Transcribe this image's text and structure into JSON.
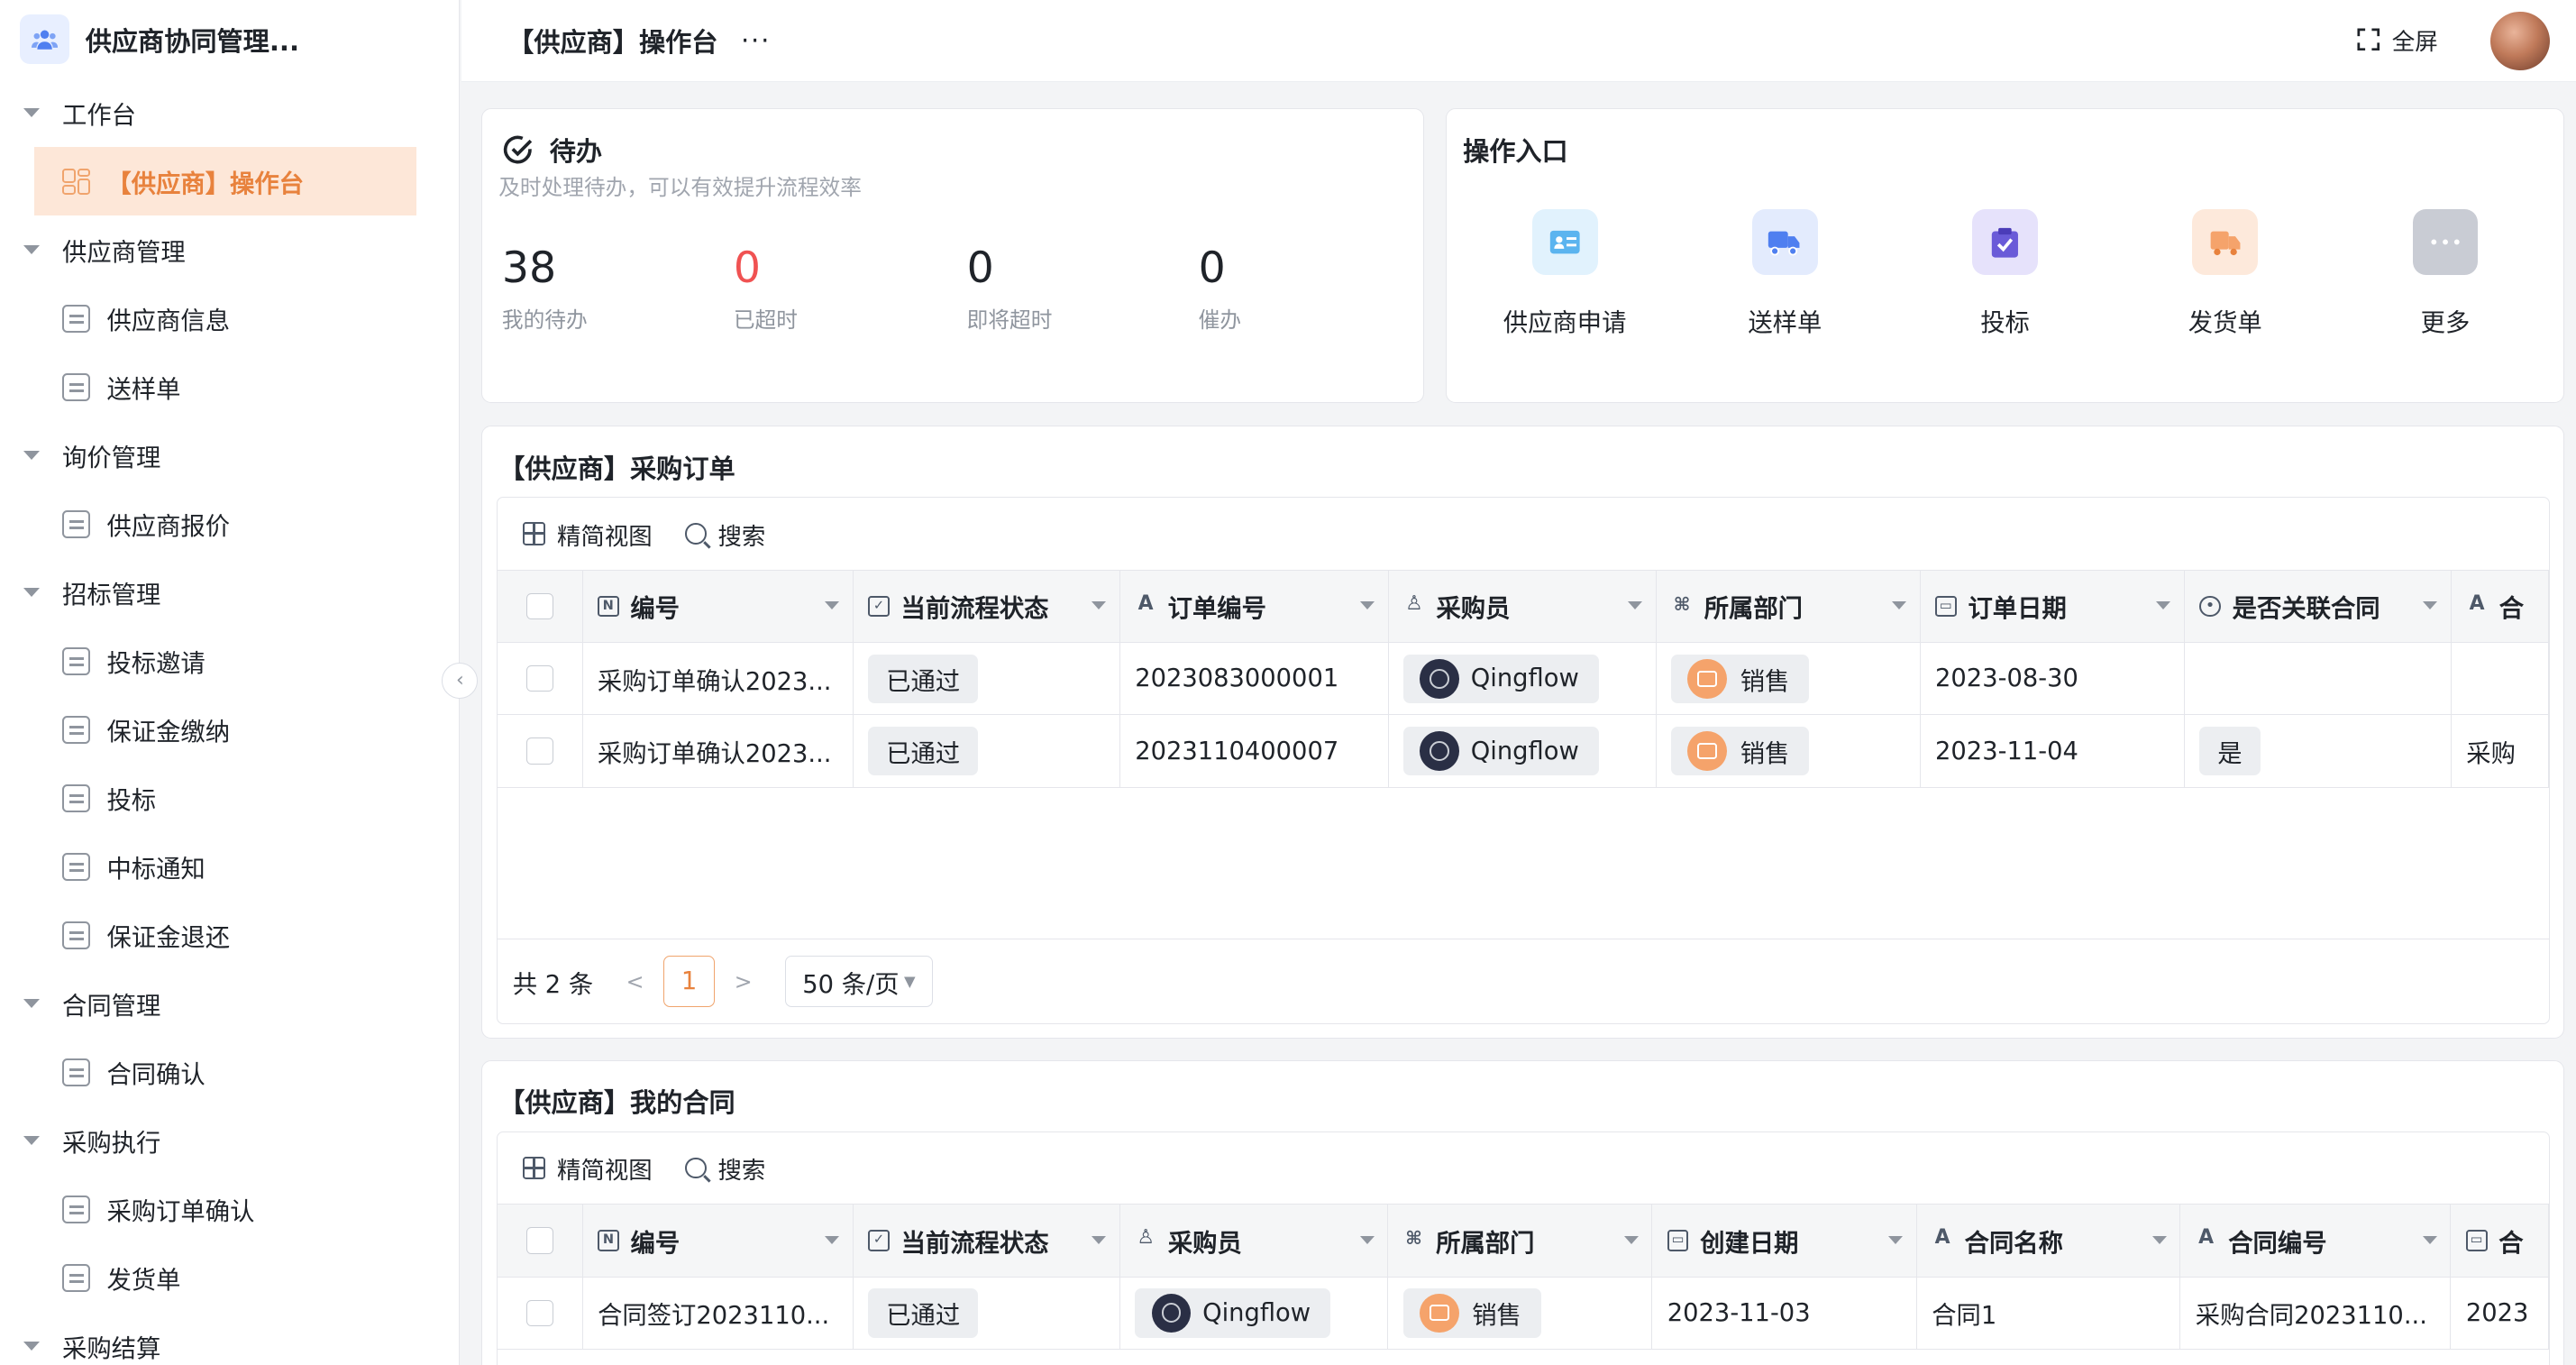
{
  "app": {
    "title": "供应商协同管理..."
  },
  "sidebar": {
    "groups": [
      {
        "label": "工作台",
        "items": [
          "【供应商】操作台"
        ]
      },
      {
        "label": "供应商管理",
        "items": [
          "供应商信息",
          "送样单"
        ]
      },
      {
        "label": "询价管理",
        "items": [
          "供应商报价"
        ]
      },
      {
        "label": "招标管理",
        "items": [
          "投标邀请",
          "保证金缴纳",
          "投标",
          "中标通知",
          "保证金退还"
        ]
      },
      {
        "label": "合同管理",
        "items": [
          "合同确认"
        ]
      },
      {
        "label": "采购执行",
        "items": [
          "采购订单确认",
          "发货单"
        ]
      },
      {
        "label": "采购结算",
        "items": []
      }
    ]
  },
  "header": {
    "title": "【供应商】操作台",
    "more": "···",
    "fullscreen": "全屏"
  },
  "todo": {
    "title": "待办",
    "subtitle": "及时处理待办，可以有效提升流程效率",
    "stats": [
      {
        "value": "38",
        "label": "我的待办"
      },
      {
        "value": "0",
        "label": "已超时"
      },
      {
        "value": "0",
        "label": "即将超时"
      },
      {
        "value": "0",
        "label": "催办"
      }
    ]
  },
  "entries": {
    "title": "操作入口",
    "items": [
      "供应商申请",
      "送样单",
      "投标",
      "发货单",
      "更多"
    ],
    "colors": [
      "#5bb4ef",
      "#4f7ff0",
      "#6a5bd8",
      "#f5a36b",
      "#b9bdc6"
    ]
  },
  "toolbar": {
    "view": "精简视图",
    "search": "搜索"
  },
  "orders": {
    "title": "【供应商】采购订单",
    "columns": [
      "编号",
      "当前流程状态",
      "订单编号",
      "采购员",
      "所属部门",
      "订单日期",
      "是否关联合同",
      "合"
    ],
    "rows": [
      [
        "采购订单确认2023...",
        "已通过",
        "2023083000001",
        "Qingflow",
        "销售",
        "2023-08-30",
        "",
        ""
      ],
      [
        "采购订单确认2023...",
        "已通过",
        "2023110400007",
        "Qingflow",
        "销售",
        "2023-11-04",
        "是",
        "采购"
      ]
    ],
    "pager": {
      "total": "共 2 条",
      "current": "1",
      "size": "50 条/页",
      "prev": "<",
      "next": ">"
    }
  },
  "contracts": {
    "title": "【供应商】我的合同",
    "columns": [
      "编号",
      "当前流程状态",
      "采购员",
      "所属部门",
      "创建日期",
      "合同名称",
      "合同编号",
      "合"
    ],
    "rows": [
      [
        "合同签订2023110...",
        "已通过",
        "Qingflow",
        "销售",
        "2023-11-03",
        "合同1",
        "采购合同2023110...",
        "2023"
      ]
    ]
  }
}
